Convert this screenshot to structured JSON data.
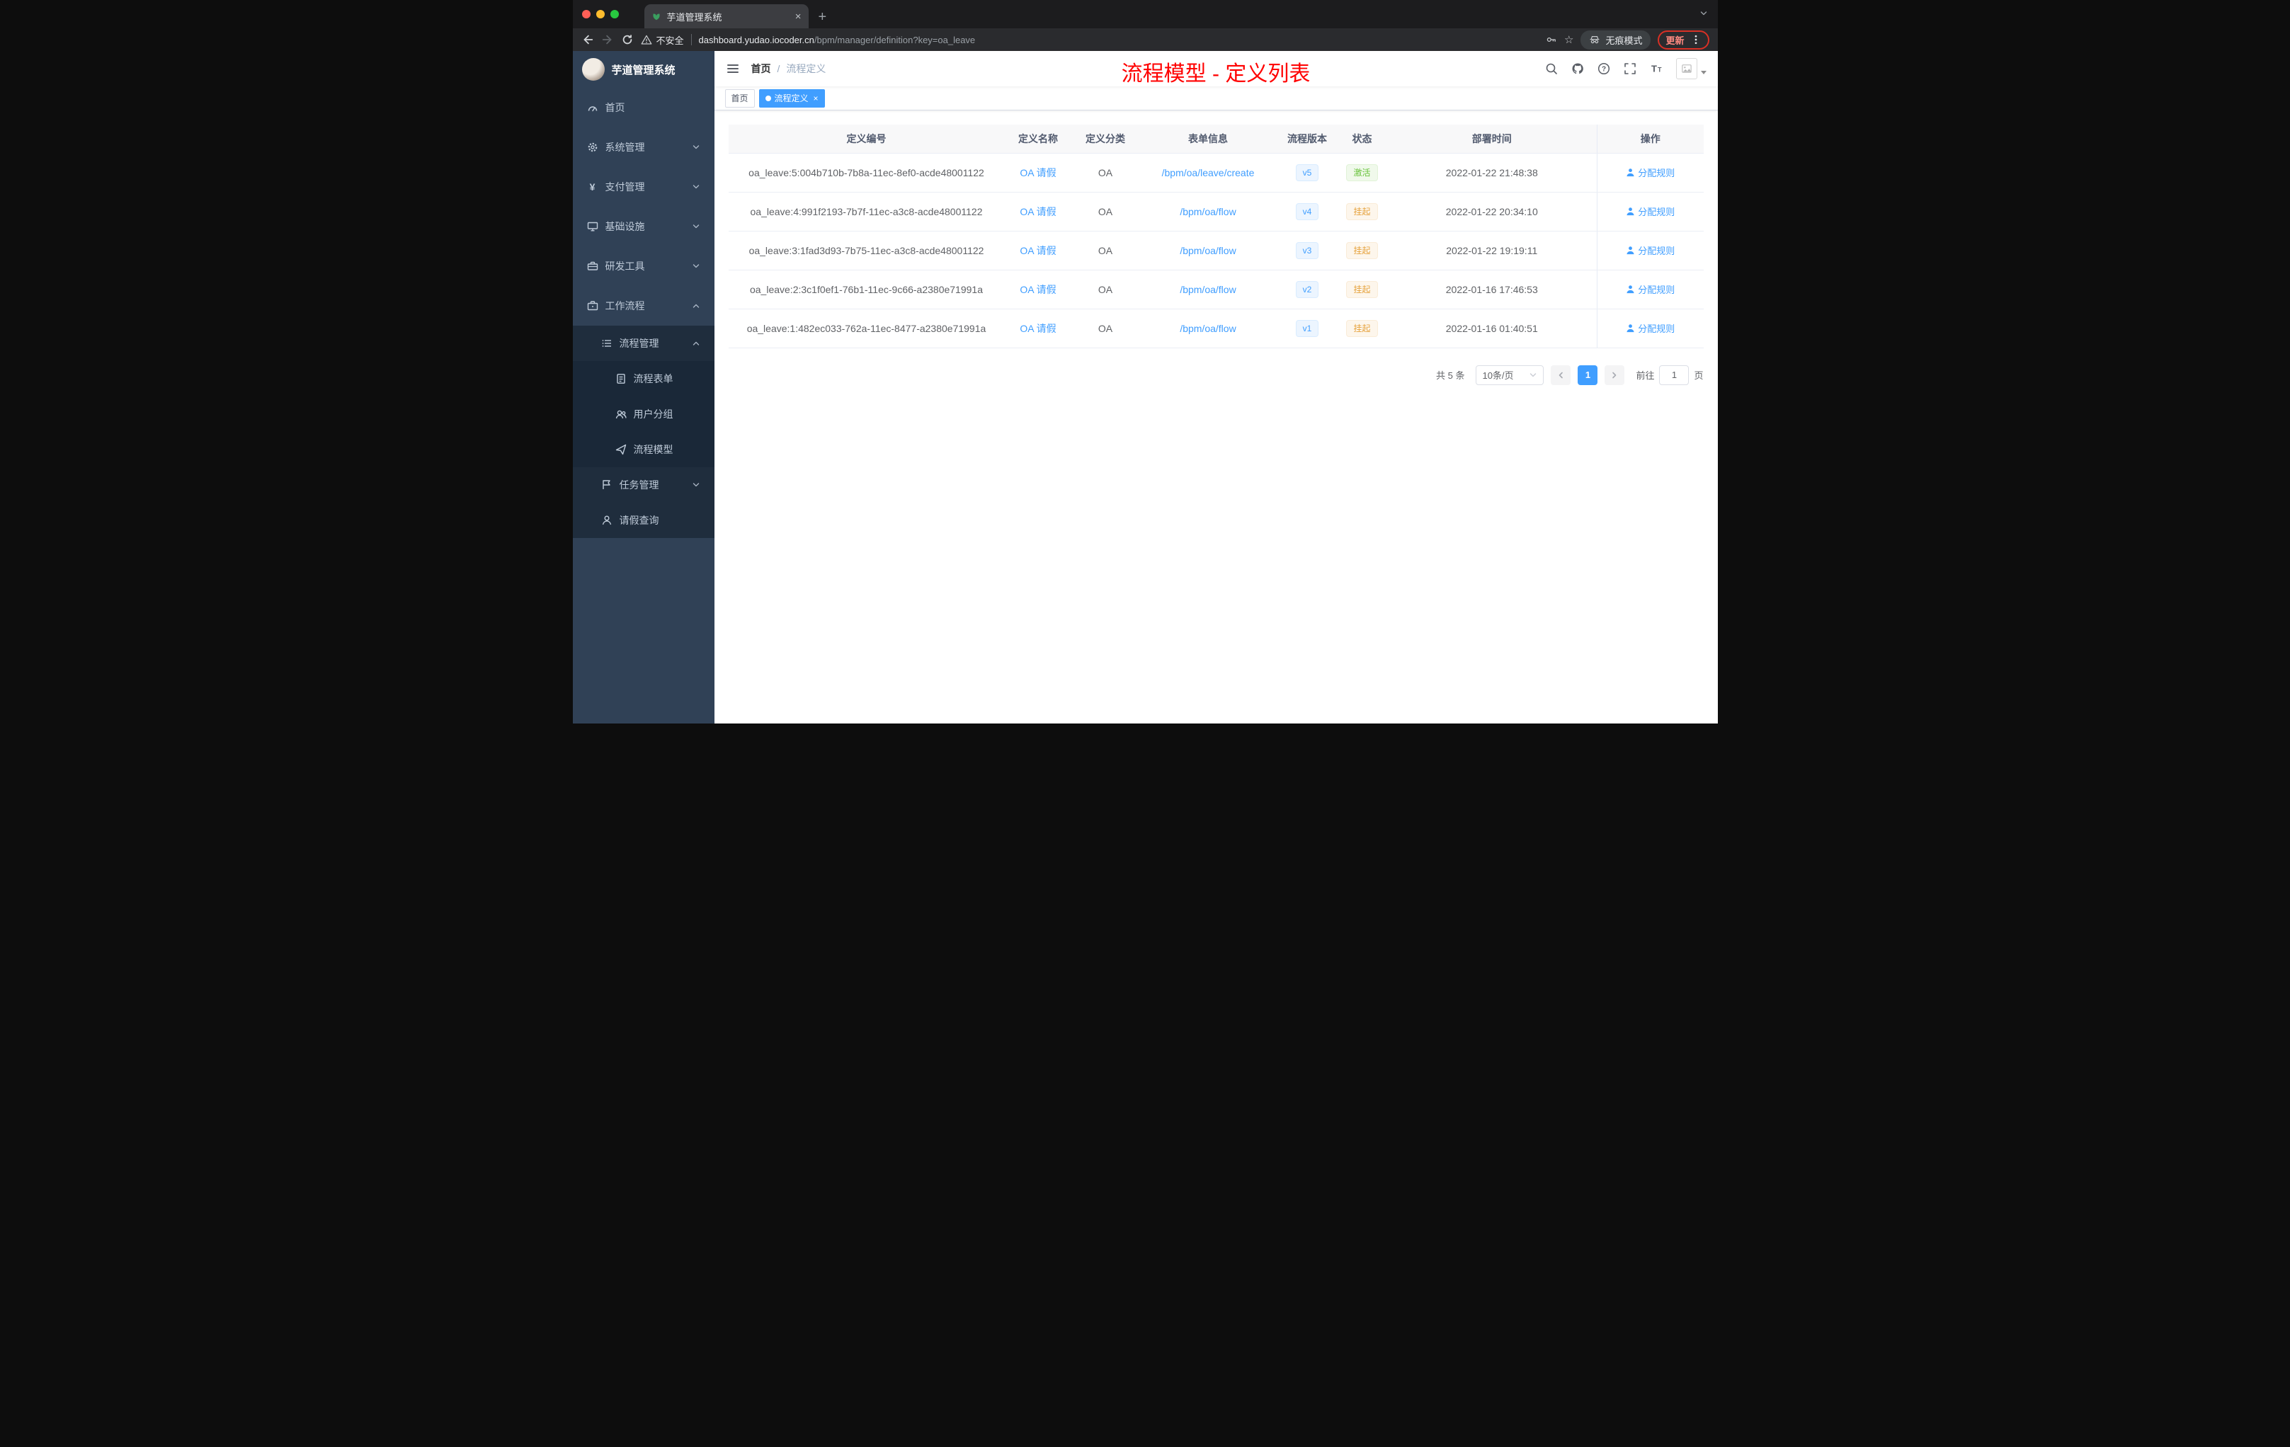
{
  "browser": {
    "tab_title": "芋道管理系统",
    "security_label": "不安全",
    "url_domain": "dashboard.yudao.iocoder.cn",
    "url_path": "/bpm/manager/definition?key=oa_leave",
    "incognito_label": "无痕模式",
    "update_label": "更新"
  },
  "sidebar": {
    "app_title": "芋道管理系统",
    "items": {
      "home": "首页",
      "system": "系统管理",
      "pay": "支付管理",
      "infra": "基础设施",
      "dev": "研发工具",
      "workflow": "工作流程",
      "process_mgmt": "流程管理",
      "process_form": "流程表单",
      "user_group": "用户分组",
      "process_model": "流程模型",
      "task_mgmt": "任务管理",
      "leave_query": "请假查询"
    }
  },
  "header": {
    "breadcrumb_home": "首页",
    "breadcrumb_sep": "/",
    "breadcrumb_current": "流程定义",
    "annotation": "流程模型 - 定义列表"
  },
  "tags": {
    "home": "首页",
    "current": "流程定义"
  },
  "table": {
    "columns": {
      "id": "定义编号",
      "name": "定义名称",
      "category": "定义分类",
      "form": "表单信息",
      "version": "流程版本",
      "status": "状态",
      "deploy_time": "部署时间",
      "action": "操作"
    },
    "rows": [
      {
        "id": "oa_leave:5:004b710b-7b8a-11ec-8ef0-acde48001122",
        "name": "OA 请假",
        "category": "OA",
        "form": "/bpm/oa/leave/create",
        "version": "v5",
        "status": "激活",
        "deploy_time": "2022-01-22 21:48:38",
        "action": "分配规则"
      },
      {
        "id": "oa_leave:4:991f2193-7b7f-11ec-a3c8-acde48001122",
        "name": "OA 请假",
        "category": "OA",
        "form": "/bpm/oa/flow",
        "version": "v4",
        "status": "挂起",
        "deploy_time": "2022-01-22 20:34:10",
        "action": "分配规则"
      },
      {
        "id": "oa_leave:3:1fad3d93-7b75-11ec-a3c8-acde48001122",
        "name": "OA 请假",
        "category": "OA",
        "form": "/bpm/oa/flow",
        "version": "v3",
        "status": "挂起",
        "deploy_time": "2022-01-22 19:19:11",
        "action": "分配规则"
      },
      {
        "id": "oa_leave:2:3c1f0ef1-76b1-11ec-9c66-a2380e71991a",
        "name": "OA 请假",
        "category": "OA",
        "form": "/bpm/oa/flow",
        "version": "v2",
        "status": "挂起",
        "deploy_time": "2022-01-16 17:46:53",
        "action": "分配规则"
      },
      {
        "id": "oa_leave:1:482ec033-762a-11ec-8477-a2380e71991a",
        "name": "OA 请假",
        "category": "OA",
        "form": "/bpm/oa/flow",
        "version": "v1",
        "status": "挂起",
        "deploy_time": "2022-01-16 01:40:51",
        "action": "分配规则"
      }
    ]
  },
  "pagination": {
    "total": "共 5 条",
    "page_size": "10条/页",
    "page": "1",
    "goto_prefix": "前往",
    "goto_page": "1",
    "goto_suffix": "页"
  },
  "colors": {
    "accent": "#409eff",
    "success": "#67c23a",
    "warning": "#e6a23c",
    "sidebar_bg": "#304156",
    "submenu_bg": "#1f2d3d",
    "annotation": "#ff0000"
  }
}
